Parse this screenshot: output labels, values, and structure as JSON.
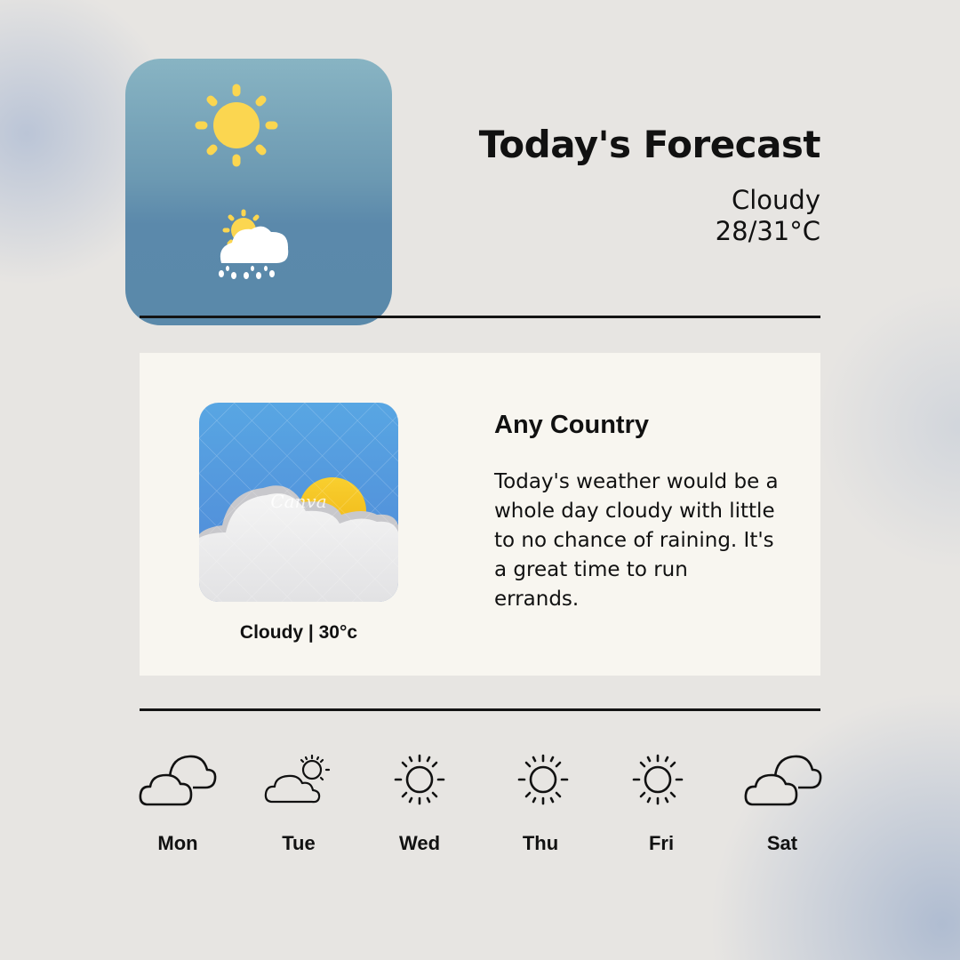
{
  "header": {
    "title": "Today's Forecast",
    "condition": "Cloudy",
    "temperature_range": "28/31°C"
  },
  "hero_tile": {
    "icons": [
      "sun-icon",
      "sun-cloud-rain-icon"
    ]
  },
  "card": {
    "image_icon": "cloudy-sun-illustration",
    "watermark": "Canva",
    "caption": "Cloudy | 30°c",
    "location": "Any Country",
    "description": "Today's weather would be a whole day cloudy with little to no chance of raining. It's a great time to run errands."
  },
  "week": [
    {
      "day": "Mon",
      "icon": "cloudy-icon"
    },
    {
      "day": "Tue",
      "icon": "partly-sunny-icon"
    },
    {
      "day": "Wed",
      "icon": "sun-icon"
    },
    {
      "day": "Thu",
      "icon": "sun-icon"
    },
    {
      "day": "Fri",
      "icon": "sun-icon"
    },
    {
      "day": "Sat",
      "icon": "cloudy-icon"
    }
  ],
  "colors": {
    "tile_top": "#88b4c3",
    "tile_bottom": "#5a89aa",
    "card_bg": "#f8f6f0",
    "sun_yellow": "#fbd650",
    "text": "#111111"
  }
}
